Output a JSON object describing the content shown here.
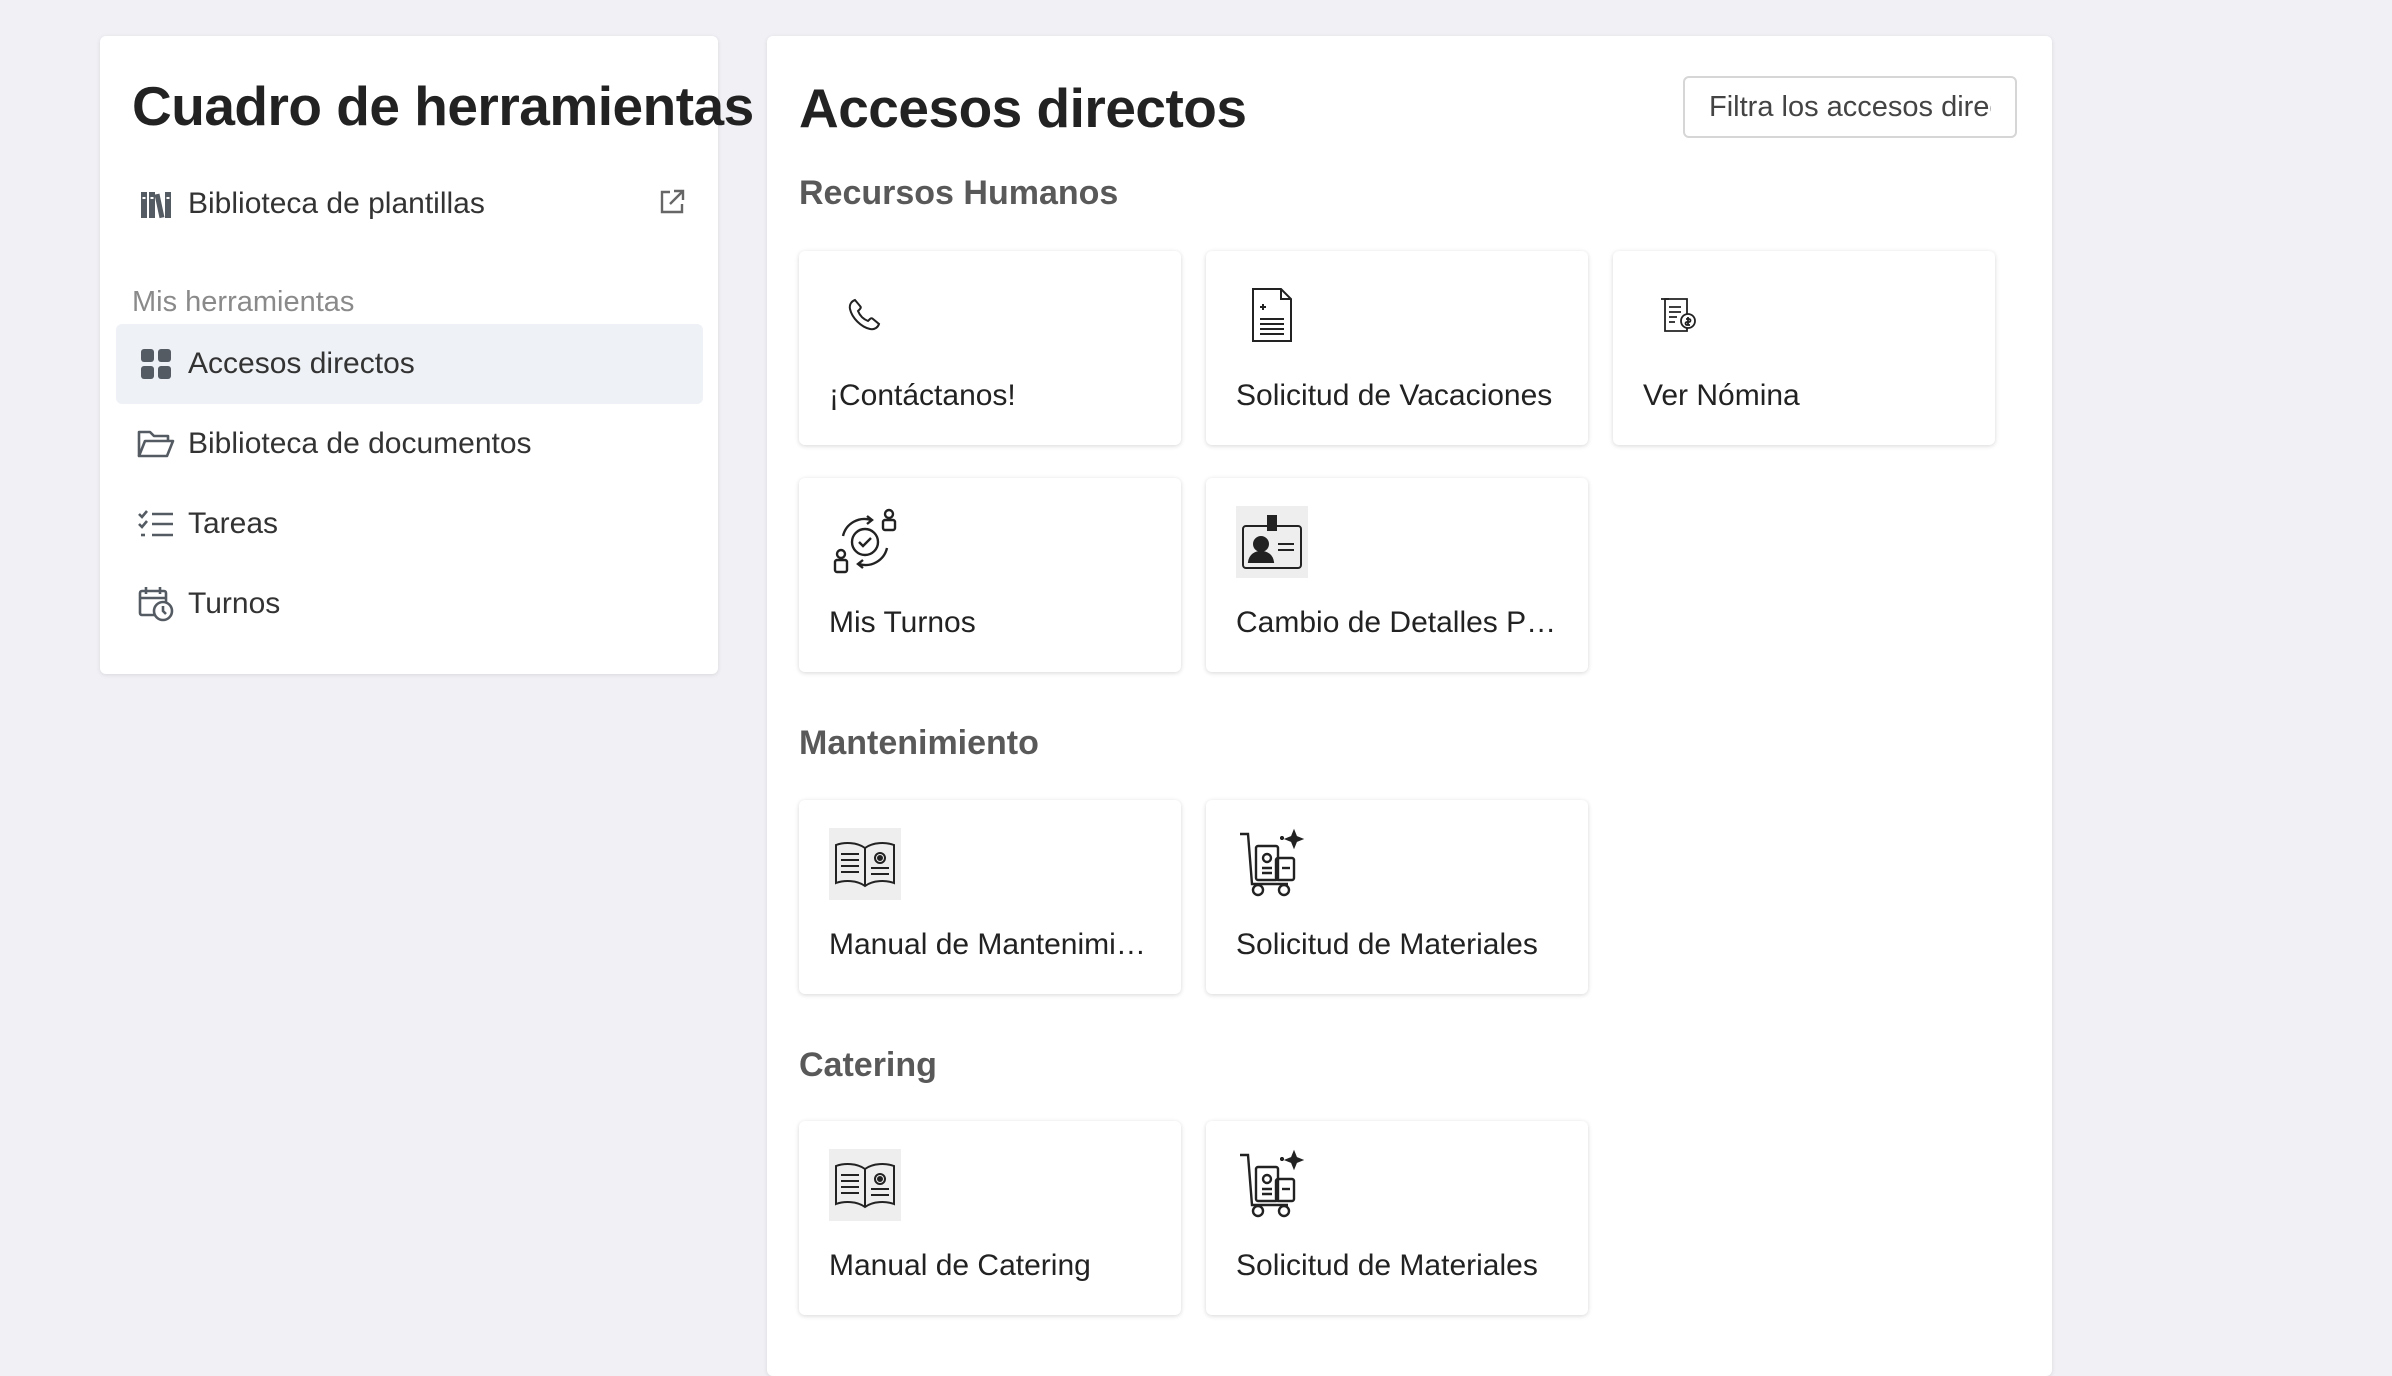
{
  "sidebar": {
    "title": "Cuadro de herramientas",
    "template_library": {
      "label": "Biblioteca de plantillas",
      "icon": "books-icon",
      "external_icon": "external-link-icon"
    },
    "section_caption": "Mis herramientas",
    "items": [
      {
        "label": "Accesos directos",
        "icon": "grid-icon",
        "active": true
      },
      {
        "label": "Biblioteca de documentos",
        "icon": "folder-open-icon",
        "active": false
      },
      {
        "label": "Tareas",
        "icon": "checklist-icon",
        "active": false
      },
      {
        "label": "Turnos",
        "icon": "calendar-clock-icon",
        "active": false
      }
    ]
  },
  "main": {
    "title": "Accesos directos",
    "filter_placeholder": "Filtra los accesos directos",
    "groups": [
      {
        "heading": "Recursos Humanos",
        "cards": [
          {
            "label": "¡Contáctanos!",
            "icon": "phone-icon"
          },
          {
            "label": "Solicitud de Vacaciones",
            "icon": "document-icon"
          },
          {
            "label": "Ver Nómina",
            "icon": "payroll-receipt-icon"
          },
          {
            "label": "Mis Turnos",
            "icon": "shift-rotation-icon"
          },
          {
            "label": "Cambio de Detalles Personales",
            "icon": "id-card-icon"
          }
        ]
      },
      {
        "heading": "Mantenimiento",
        "cards": [
          {
            "label": "Manual de Mantenimiento",
            "icon": "manual-book-icon"
          },
          {
            "label": "Solicitud de Materiales",
            "icon": "materials-cart-icon"
          }
        ]
      },
      {
        "heading": "Catering",
        "cards": [
          {
            "label": "Manual de Catering",
            "icon": "manual-book-icon"
          },
          {
            "label": "Solicitud de Materiales",
            "icon": "materials-cart-icon"
          }
        ]
      }
    ]
  },
  "colors": {
    "background": "#f0f0f5",
    "active_item": "#eef1f5",
    "heading_gray": "#595959",
    "icon_gray": "#555b63"
  }
}
